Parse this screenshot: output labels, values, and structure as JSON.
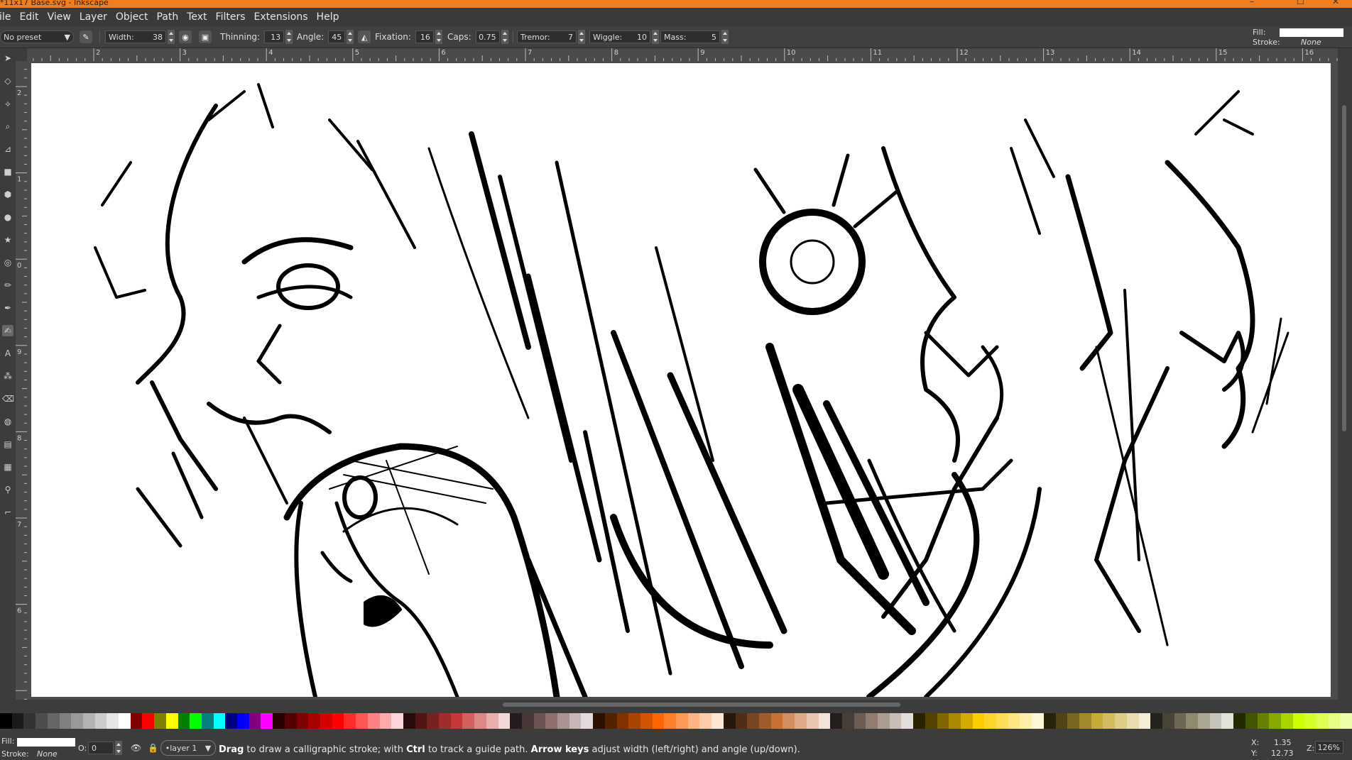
{
  "window": {
    "title": "*11x17 Base.svg - Inkscape",
    "min_glyph": "–",
    "max_glyph": "☐",
    "close_glyph": "✕"
  },
  "menu": [
    "File",
    "Edit",
    "View",
    "Layer",
    "Object",
    "Path",
    "Text",
    "Filters",
    "Extensions",
    "Help"
  ],
  "tool_controls": {
    "preset": "No preset",
    "width_label": "Width:",
    "width_value": "38",
    "thinning_label": "Thinning:",
    "thinning_value": "13",
    "angle_label": "Angle:",
    "angle_value": "45",
    "fixation_label": "Fixation:",
    "fixation_value": "16",
    "caps_label": "Caps:",
    "caps_value": "0.75",
    "tremor_label": "Tremor:",
    "tremor_value": "7",
    "wiggle_label": "Wiggle:",
    "wiggle_value": "10",
    "mass_label": "Mass:",
    "mass_value": "5"
  },
  "style_indicator": {
    "fill_label": "Fill:",
    "stroke_label": "Stroke:",
    "stroke_value": "None",
    "fill_color": "#ffffff"
  },
  "ruler_h": [
    "2",
    "3",
    "4",
    "5",
    "6",
    "7",
    "8",
    "9",
    "10",
    "11",
    "12",
    "13",
    "14",
    "15",
    "16"
  ],
  "ruler_v": [
    "2",
    "1",
    "0",
    "9",
    "8",
    "7",
    "6"
  ],
  "palette": [
    "#000000",
    "#1a1a1a",
    "#333333",
    "#4d4d4d",
    "#666666",
    "#808080",
    "#999999",
    "#b3b3b3",
    "#cccccc",
    "#e6e6e6",
    "#ffffff",
    "#800000",
    "#ff0000",
    "#808000",
    "#ffff00",
    "#008000",
    "#00ff00",
    "#008080",
    "#00ffff",
    "#000080",
    "#0000ff",
    "#800080",
    "#ff00ff",
    "#2b0000",
    "#550000",
    "#800000",
    "#aa0000",
    "#d40000",
    "#ff0000",
    "#ff2a2a",
    "#ff5555",
    "#ff8080",
    "#ffaaaa",
    "#ffd5d5",
    "#280b0b",
    "#501616",
    "#782121",
    "#a02c2c",
    "#c83737",
    "#d35f5f",
    "#de8787",
    "#e9afaf",
    "#f4d7d7",
    "#241c1c",
    "#483737",
    "#6c5353",
    "#916f6f",
    "#ac9393",
    "#c8b7b7",
    "#e3dbdb",
    "#2b1100",
    "#552200",
    "#803300",
    "#aa4400",
    "#d45500",
    "#ff6600",
    "#ff7f2a",
    "#ff9955",
    "#ffb380",
    "#ffccaa",
    "#ffe6d5",
    "#28170b",
    "#502d16",
    "#784421",
    "#a05a2c",
    "#c87137",
    "#d38d5f",
    "#deaa87",
    "#e9c6af",
    "#f4e3d7",
    "#241f1c",
    "#483e37",
    "#6c5d53",
    "#917c6f",
    "#ac9d93",
    "#c8beb7",
    "#e3dedb",
    "#2b2200",
    "#554400",
    "#806600",
    "#aa8800",
    "#d4aa00",
    "#ffcc00",
    "#ffd42a",
    "#ffdd55",
    "#ffe680",
    "#ffeeaa",
    "#fff6d5",
    "#28220b",
    "#504416",
    "#786721",
    "#a0892c",
    "#c8ab37",
    "#d3bc5f",
    "#decd87",
    "#e9ddaf",
    "#f4eed7",
    "#24221c",
    "#484537",
    "#6c6753",
    "#918a6f",
    "#aca793",
    "#c8c4b7",
    "#e3e2db",
    "#222b00",
    "#445500",
    "#668000",
    "#88aa00",
    "#aad400",
    "#ccff00",
    "#d4ff2a",
    "#ddff55",
    "#e5ff80",
    "#eeffaa"
  ],
  "status": {
    "fill_label": "Fill:",
    "stroke_label": "Stroke:",
    "stroke_value": "None",
    "opacity_label": "O:",
    "opacity_value": "0",
    "layer_name": "•layer 1",
    "message_drag": "Drag",
    "message_1": " to draw a calligraphic stroke; with ",
    "message_ctrl": "Ctrl",
    "message_2": " to track a guide path. ",
    "message_arrows": "Arrow keys",
    "message_3": " adjust width (left/right) and angle (up/down).",
    "x_label": "X:",
    "x_value": "1.35",
    "y_label": "Y:",
    "y_value": "12.73",
    "zoom_label": "Z:",
    "zoom_value": "126%"
  }
}
